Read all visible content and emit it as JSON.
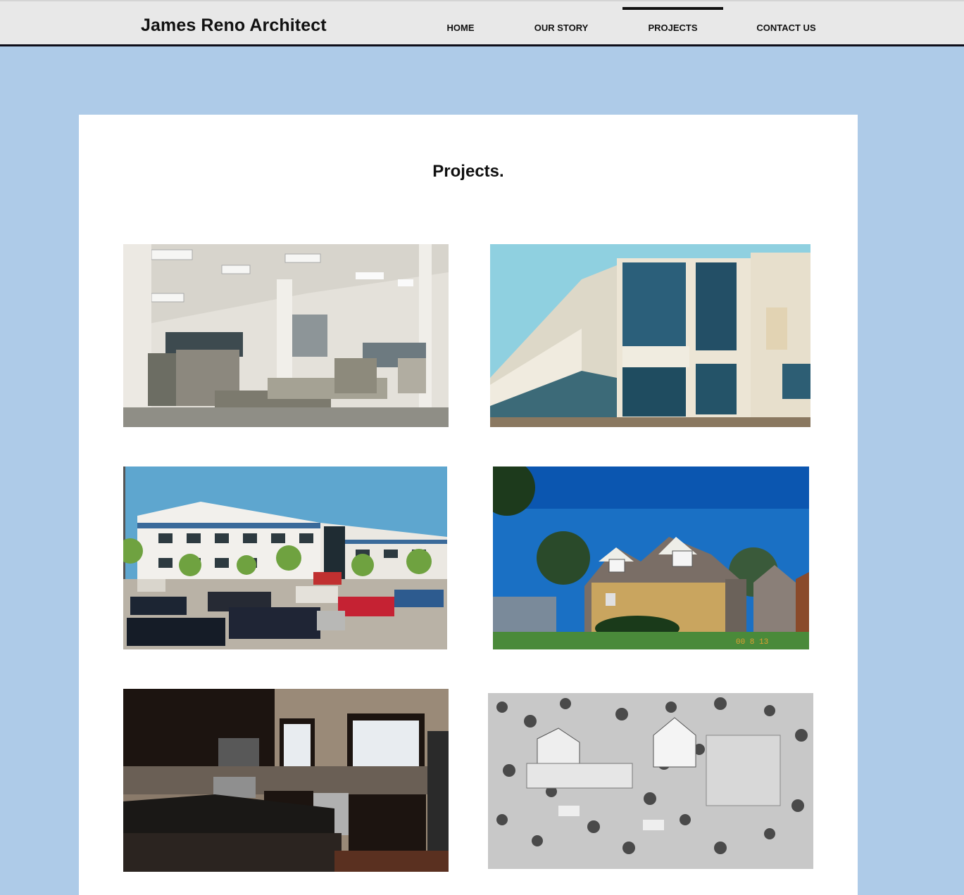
{
  "header": {
    "brand": "James Reno Architect",
    "nav": [
      {
        "label": "HOME",
        "active": false
      },
      {
        "label": "OUR STORY",
        "active": false
      },
      {
        "label": "PROJECTS",
        "active": true
      },
      {
        "label": "CONTACT US",
        "active": false
      }
    ]
  },
  "main": {
    "title": "Projects.",
    "gallery": [
      {
        "subject": "office-interior-photo"
      },
      {
        "subject": "glass-office-building-photo"
      },
      {
        "subject": "office-building-parking-lot-photo"
      },
      {
        "subject": "brick-house-photo"
      },
      {
        "subject": "kitchen-interior-photo"
      },
      {
        "subject": "site-model-aerial-photo"
      }
    ]
  },
  "colors": {
    "page_background": "#aecbe8",
    "header_background": "#e8e8e8",
    "header_border": "#0e0e1a",
    "panel_background": "#ffffff"
  }
}
